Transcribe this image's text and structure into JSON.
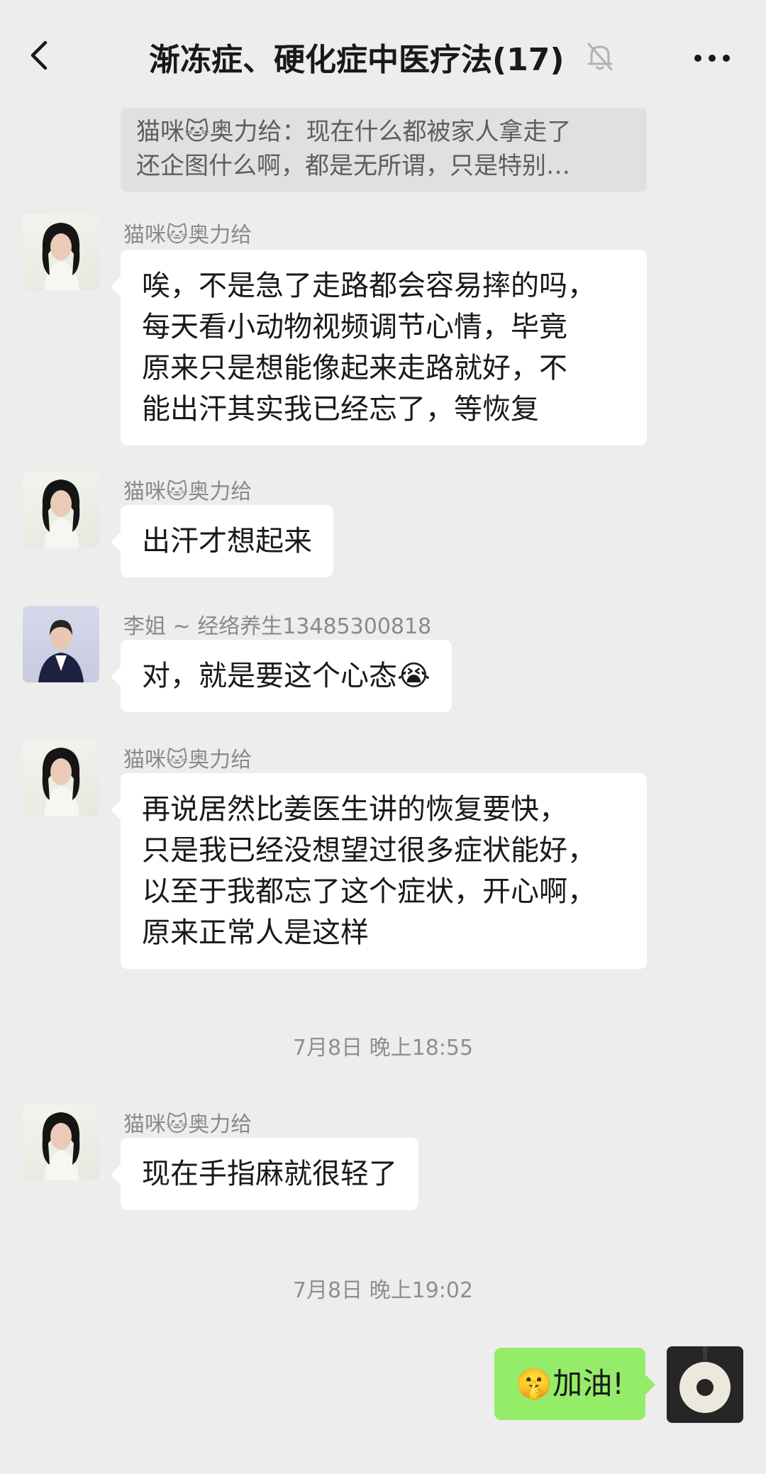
{
  "header": {
    "title": "渐冻症、硬化症中医疗法(17)",
    "back_icon": "chevron-left-icon",
    "mute_icon": "bell-off-icon",
    "more_icon": "more-dots-icon"
  },
  "quote": {
    "line1": "猫咪🐱奥力给：现在什么都被家人拿走了",
    "line2": "还企图什么啊，都是无所谓，只是特别…"
  },
  "messages": [
    {
      "sender": "猫咪🐱奥力给",
      "lines": [
        "唉，不是急了走路都会容易摔的吗，",
        "每天看小动物视频调节心情，毕竟",
        "原来只是想能像起来走路就好，不",
        "能出汗其实我已经忘了，等恢复"
      ]
    },
    {
      "sender": "猫咪🐱奥力给",
      "lines": [
        "出汗才想起来"
      ]
    },
    {
      "sender": "李姐 ~ 经络养生13485300818",
      "lines": [
        "对，就是要这个心态😭"
      ]
    },
    {
      "sender": "猫咪🐱奥力给",
      "lines": [
        "再说居然比姜医生讲的恢复要快，",
        "只是我已经没想望过很多症状能好，",
        "以至于我都忘了这个症状，开心啊，",
        "原来正常人是这样"
      ]
    },
    {
      "sender": "猫咪🐱奥力给",
      "lines": [
        "现在手指麻就很轻了"
      ]
    }
  ],
  "timestamps": [
    "7月8日 晚上18:55",
    "7月8日 晚上19:02"
  ],
  "my_message": {
    "text": "🤫加油!"
  },
  "colors": {
    "background": "#ededed",
    "bubble_received": "#ffffff",
    "bubble_sent": "#95ec69",
    "sender_name": "#8a8a8a"
  }
}
